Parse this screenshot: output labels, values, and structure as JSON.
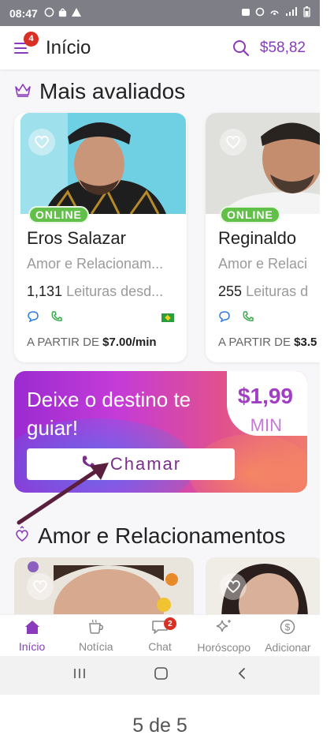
{
  "status_bar": {
    "time": "08:47",
    "left_icons": [
      "whatsapp-icon",
      "bag-icon",
      "warning-icon"
    ],
    "right_icons": [
      "alarm-icon",
      "nfc-icon",
      "hotspot-icon",
      "signal-icon",
      "battery-icon"
    ]
  },
  "header": {
    "menu_badge": "4",
    "title": "Início",
    "balance": "$58,82"
  },
  "sections": {
    "top_rated": "Mais avaliados",
    "love": "Amor e Relacionamentos"
  },
  "advisors": [
    {
      "online_label": "ONLINE",
      "name": "Eros Salazar",
      "category": "Amor e Relacionam...",
      "readings_count": "1,131",
      "readings_text": "Leituras desd...",
      "price_prefix": "A PARTIR DE",
      "price": "$7.00/min"
    },
    {
      "online_label": "ONLINE",
      "name": "Reginaldo",
      "category": "Amor e Relaci",
      "readings_count": "255",
      "readings_text": "Leituras d",
      "price_prefix": "A PARTIR DE",
      "price": "$3.5"
    }
  ],
  "promo": {
    "text": "Deixe o destino te guiar!",
    "price": "$1,99",
    "unit": "MIN",
    "call_label": "Chamar"
  },
  "bottom_nav": [
    {
      "label": "Início",
      "icon": "home-icon"
    },
    {
      "label": "Notícia",
      "icon": "coffee-cup-icon"
    },
    {
      "label": "Chat",
      "icon": "chat-icon",
      "badge": "2"
    },
    {
      "label": "Horóscopo",
      "icon": "sparkle-icon"
    },
    {
      "label": "Adicionar",
      "icon": "dollar-icon"
    }
  ],
  "page_counter": "5 de 5",
  "colors": {
    "brand_purple": "#8a3bbd",
    "online_green": "#62bf4a",
    "badge_red": "#d93025"
  }
}
